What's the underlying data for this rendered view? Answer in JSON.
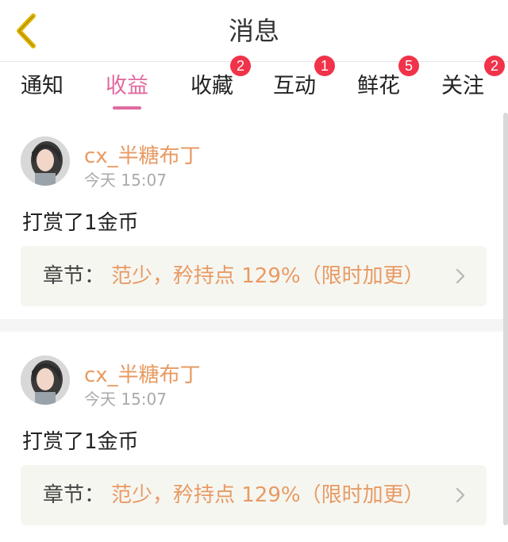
{
  "header": {
    "title": "消息",
    "back_icon": "chevron-left-icon",
    "accent_color": "#e0b400"
  },
  "tabs": [
    {
      "label": "通知",
      "badge": ""
    },
    {
      "label": "收益",
      "badge": "",
      "active": true
    },
    {
      "label": "收藏",
      "badge": "2"
    },
    {
      "label": "互动",
      "badge": "1"
    },
    {
      "label": "鲜花",
      "badge": "5"
    },
    {
      "label": "关注",
      "badge": "2"
    }
  ],
  "colors": {
    "active_tab": "#e06aa0",
    "badge": "#f0334a",
    "username": "#e89a62",
    "chapter_bg": "#f6f6f1"
  },
  "messages": [
    {
      "username": "cx_半糖布丁",
      "time": "今天 15:07",
      "text": "打赏了1金币",
      "chapter_label": "章节：",
      "chapter_title": "范少，矜持点 129%（限时加更）"
    },
    {
      "username": "cx_半糖布丁",
      "time": "今天 15:07",
      "text": "打赏了1金币",
      "chapter_label": "章节：",
      "chapter_title": "范少，矜持点 129%（限时加更）"
    }
  ]
}
